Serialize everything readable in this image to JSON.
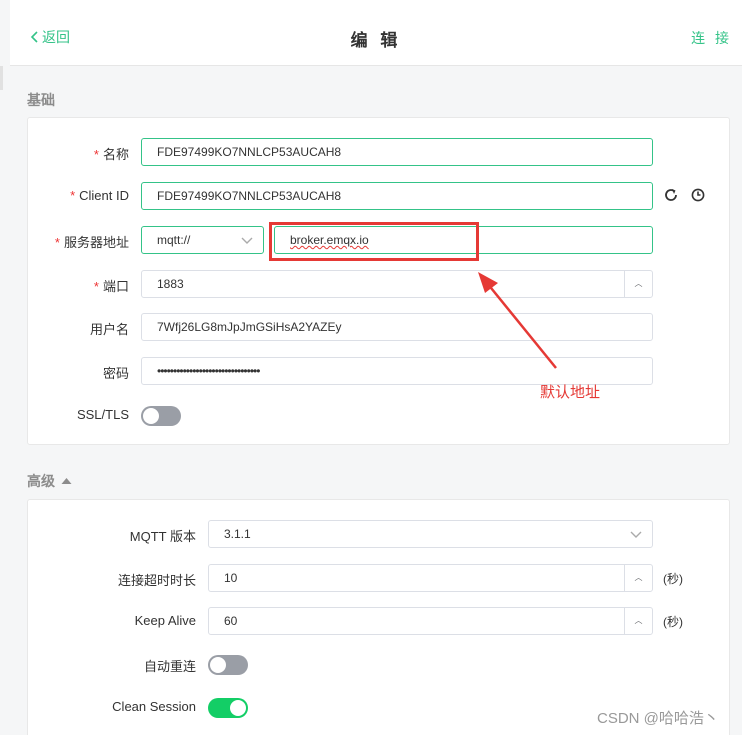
{
  "header": {
    "back_label": "返回",
    "title": "编 辑",
    "connect_label": "连 接"
  },
  "basic": {
    "section_title": "基础",
    "name": {
      "label": "名称",
      "value": "FDE97499KO7NNLCP53AUCAH8"
    },
    "client_id": {
      "label": "Client ID",
      "value": "FDE97499KO7NNLCP53AUCAH8"
    },
    "server": {
      "label": "服务器地址",
      "protocol": "mqtt://",
      "host": "broker.emqx.io"
    },
    "port": {
      "label": "端口",
      "value": "1883"
    },
    "username": {
      "label": "用户名",
      "value": "7Wfj26LG8mJpJmGSiHsA2YAZEy"
    },
    "password": {
      "label": "密码",
      "value": "••••••••••••••••••••••••••••••••"
    },
    "ssl": {
      "label": "SSL/TLS",
      "enabled": false
    }
  },
  "advanced": {
    "section_title": "高级",
    "collapse_icon": "caret-up-icon",
    "mqtt_version": {
      "label": "MQTT 版本",
      "value": "3.1.1"
    },
    "connect_timeout": {
      "label": "连接超时时长",
      "value": "10",
      "unit": "(秒)"
    },
    "keep_alive": {
      "label": "Keep Alive",
      "value": "60",
      "unit": "(秒)"
    },
    "auto_reconnect": {
      "label": "自动重连",
      "enabled": false
    },
    "clean_session": {
      "label": "Clean Session",
      "enabled": true
    }
  },
  "annotation": {
    "text": "默认地址",
    "color": "#e53935"
  },
  "watermark": "CSDN @哈哈浩丶",
  "colors": {
    "accent": "#34c388",
    "toggle_on": "#13ce66",
    "toggle_off": "#9a9ea6"
  }
}
